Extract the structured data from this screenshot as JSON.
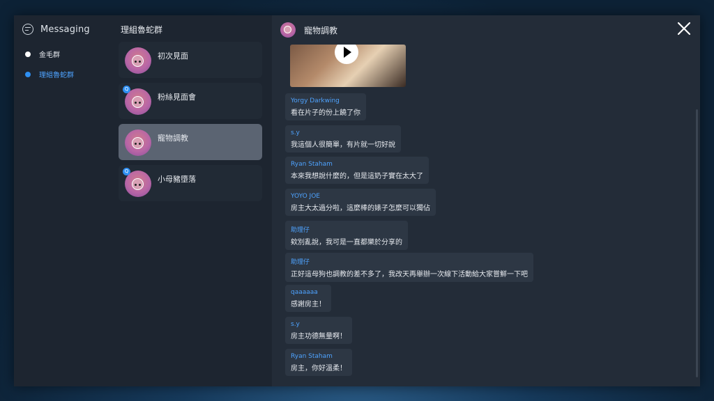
{
  "sidebar": {
    "title": "Messaging",
    "groups": [
      {
        "label": "金毛群"
      },
      {
        "label": "理組魯蛇群"
      }
    ]
  },
  "chat_list": {
    "title": "理組魯蛇群",
    "items": [
      {
        "name": "初次見面"
      },
      {
        "name": "粉絲見面會",
        "badge": "Q"
      },
      {
        "name": "寵物調教"
      },
      {
        "name": "小母豬墮落",
        "badge": "Q"
      }
    ]
  },
  "chat": {
    "title": "寵物調教",
    "messages": [
      {
        "sender": "Yorgy Darkwing",
        "text": "看在片子的份上饒了你"
      },
      {
        "sender": "s.y",
        "text": "我這個人很簡單，有片就一切好說"
      },
      {
        "sender": "Ryan Staham",
        "text": "本來我想說什麼的，但是這奶子實在太大了"
      },
      {
        "sender": "YOYO JOE",
        "text": "房主大太過分啦，這麼棒的婊子怎麼可以獨佔"
      },
      {
        "sender": "助理仔",
        "text": "欸別亂說，我可是一直都樂於分享的"
      },
      {
        "sender": "助理仔",
        "text": "正好這母狗也調教的差不多了，我改天再舉辦一次線下活動給大家嘗鮮一下吧"
      },
      {
        "sender": "qaaaaaa",
        "text": "感謝房主！"
      },
      {
        "sender": "s.y",
        "text": "房主功德無量啊！"
      },
      {
        "sender": "Ryan Staham",
        "text": "房主，你好溫柔！"
      }
    ]
  },
  "colors": {
    "accent": "#2e8ff2",
    "window_bg": "#1d2530",
    "chat_bg": "#232c38",
    "bubble_bg": "#2d3744"
  }
}
